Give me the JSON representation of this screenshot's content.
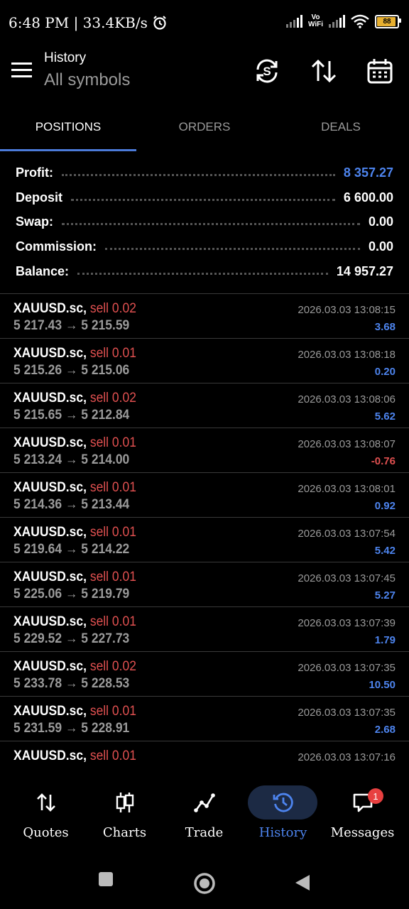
{
  "status_bar": {
    "time": "6:48 PM | 33.4KB/s",
    "vowifi_top": "Vo",
    "vowifi_bottom": "WiFi",
    "battery": "88"
  },
  "header": {
    "title": "History",
    "subtitle": "All symbols",
    "icons": [
      "menu-icon",
      "sync-icon",
      "sort-icon",
      "calendar-icon"
    ]
  },
  "tabs": [
    {
      "label": "POSITIONS",
      "active": true
    },
    {
      "label": "ORDERS",
      "active": false
    },
    {
      "label": "DEALS",
      "active": false
    }
  ],
  "summary": [
    {
      "label": "Profit:",
      "value": "8 357.27",
      "color": "#4d84ee"
    },
    {
      "label": "Deposit",
      "value": "6 600.00"
    },
    {
      "label": "Swap:",
      "value": "0.00"
    },
    {
      "label": "Commission:",
      "value": "0.00"
    },
    {
      "label": "Balance:",
      "value": "14 957.27"
    }
  ],
  "trades": [
    {
      "symbol": "XAUUSD.sc,",
      "side": "sell 0.02",
      "prices": "5 217.43 → 5 215.59",
      "time": "2026.03.03 13:08:15",
      "profit": "3.68"
    },
    {
      "symbol": "XAUUSD.sc,",
      "side": "sell 0.01",
      "prices": "5 215.26 → 5 215.06",
      "time": "2026.03.03 13:08:18",
      "profit": "0.20"
    },
    {
      "symbol": "XAUUSD.sc,",
      "side": "sell 0.02",
      "prices": "5 215.65 → 5 212.84",
      "time": "2026.03.03 13:08:06",
      "profit": "5.62"
    },
    {
      "symbol": "XAUUSD.sc,",
      "side": "sell 0.01",
      "prices": "5 213.24 → 5 214.00",
      "time": "2026.03.03 13:08:07",
      "profit": "-0.76"
    },
    {
      "symbol": "XAUUSD.sc,",
      "side": "sell 0.01",
      "prices": "5 214.36 → 5 213.44",
      "time": "2026.03.03 13:08:01",
      "profit": "0.92"
    },
    {
      "symbol": "XAUUSD.sc,",
      "side": "sell 0.01",
      "prices": "5 219.64 → 5 214.22",
      "time": "2026.03.03 13:07:54",
      "profit": "5.42"
    },
    {
      "symbol": "XAUUSD.sc,",
      "side": "sell 0.01",
      "prices": "5 225.06 → 5 219.79",
      "time": "2026.03.03 13:07:45",
      "profit": "5.27"
    },
    {
      "symbol": "XAUUSD.sc,",
      "side": "sell 0.01",
      "prices": "5 229.52 → 5 227.73",
      "time": "2026.03.03 13:07:39",
      "profit": "1.79"
    },
    {
      "symbol": "XAUUSD.sc,",
      "side": "sell 0.02",
      "prices": "5 233.78 → 5 228.53",
      "time": "2026.03.03 13:07:35",
      "profit": "10.50"
    },
    {
      "symbol": "XAUUSD.sc,",
      "side": "sell 0.01",
      "prices": "5 231.59 → 5 228.91",
      "time": "2026.03.03 13:07:35",
      "profit": "2.68"
    },
    {
      "symbol": "XAUUSD.sc,",
      "side": "sell 0.01",
      "prices": "",
      "time": "2026.03.03 13:07:16",
      "profit": ""
    }
  ],
  "bottom_nav": [
    {
      "label": "Quotes",
      "icon": "quotes-arrows-icon",
      "active": false
    },
    {
      "label": "Charts",
      "icon": "candlestick-icon",
      "active": false
    },
    {
      "label": "Trade",
      "icon": "trend-line-icon",
      "active": false
    },
    {
      "label": "History",
      "icon": "history-clock-icon",
      "active": true
    },
    {
      "label": "Messages",
      "icon": "chat-icon",
      "active": false,
      "badge": "1"
    }
  ],
  "colors": {
    "accent": "#4d84ee",
    "sell": "#e05050",
    "negative": "#e05050",
    "muted": "#9a9a9a",
    "background": "#000000"
  }
}
